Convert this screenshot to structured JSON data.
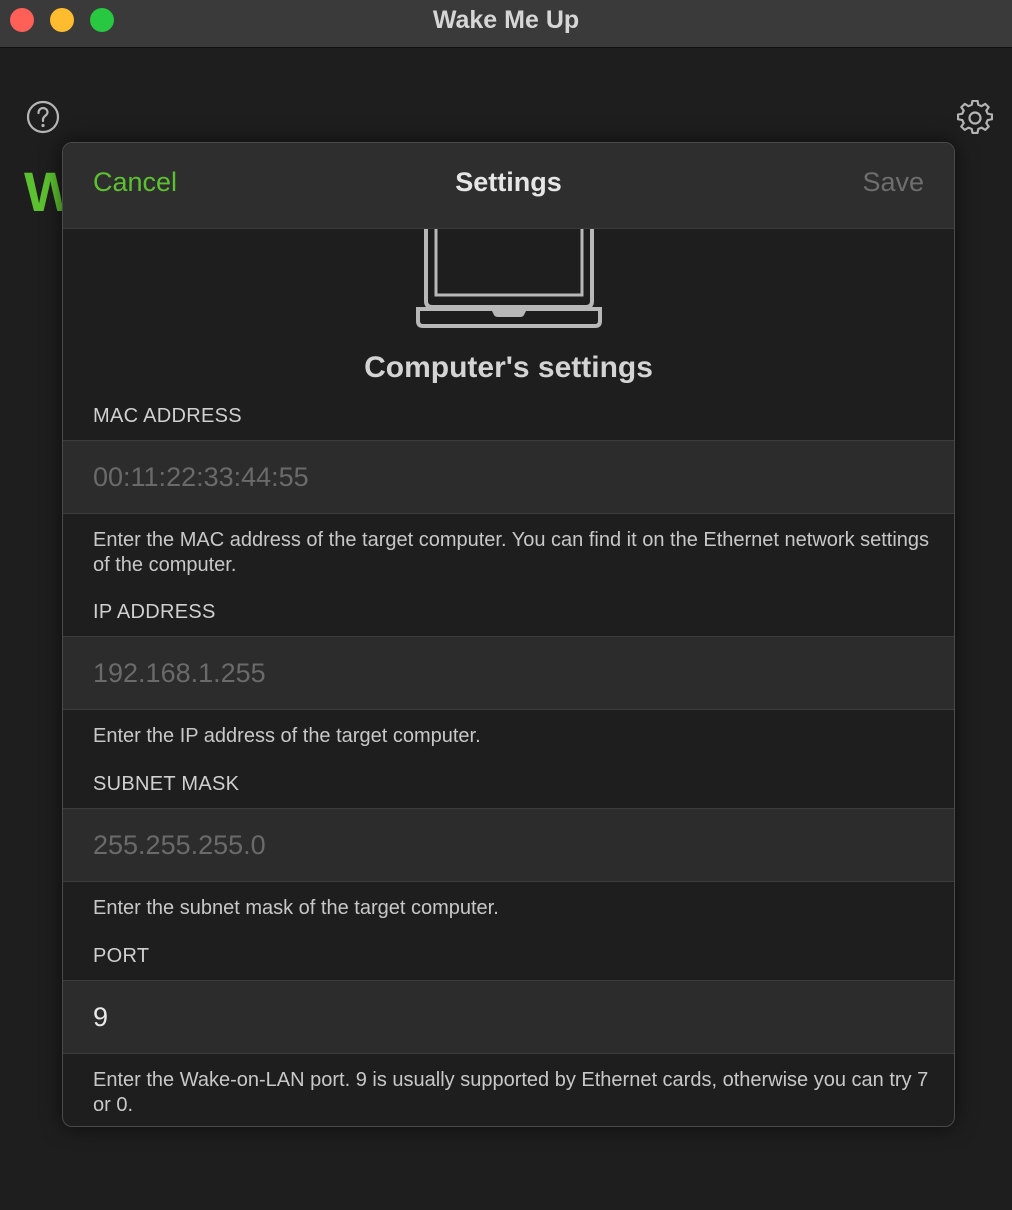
{
  "window": {
    "title": "Wake Me Up"
  },
  "background": {
    "heading_fragment": "W"
  },
  "sheet": {
    "cancel_label": "Cancel",
    "title": "Settings",
    "save_label": "Save",
    "section_heading": "Computer's settings",
    "fields": {
      "mac": {
        "label": "MAC ADDRESS",
        "value": "",
        "placeholder": "00:11:22:33:44:55",
        "help": "Enter the MAC address of the target computer. You can find it on the Ethernet network settings of the computer."
      },
      "ip": {
        "label": "IP ADDRESS",
        "value": "",
        "placeholder": "192.168.1.255",
        "help": "Enter the IP address of the target computer."
      },
      "subnet": {
        "label": "SUBNET MASK",
        "value": "",
        "placeholder": "255.255.255.0",
        "help": "Enter the subnet mask of the target computer."
      },
      "port": {
        "label": "PORT",
        "value": "9",
        "placeholder": "",
        "help": "Enter the Wake-on-LAN port. 9 is usually supported by Ethernet cards, otherwise you can try 7 or 0."
      }
    }
  },
  "icons": {
    "help": "help-icon",
    "settings": "gear-icon",
    "computer": "laptop-icon"
  },
  "colors": {
    "accent": "#5cc130",
    "disabled": "#6e6e6e",
    "background": "#1e1e1e"
  }
}
